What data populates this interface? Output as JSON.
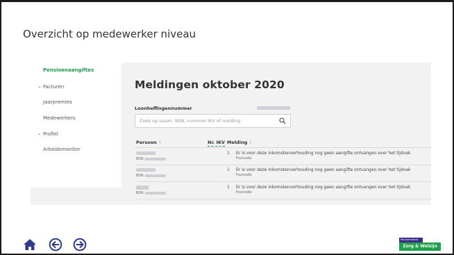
{
  "slide": {
    "title": "Overzicht op medewerker niveau"
  },
  "sidebar": {
    "items": [
      {
        "label": "Pensioenaangiftes",
        "active": true,
        "chevron": false
      },
      {
        "label": "Facturen",
        "active": false,
        "chevron": true
      },
      {
        "label": "Jaarpremies",
        "active": false,
        "chevron": false
      },
      {
        "label": "Medewerkers",
        "active": false,
        "chevron": false
      },
      {
        "label": "Profiel",
        "active": false,
        "chevron": true
      },
      {
        "label": "Arbeidsmonitor",
        "active": false,
        "chevron": false
      }
    ]
  },
  "main": {
    "title": "Meldingen oktober 2020",
    "loonheffing_label": "Loonheffingennummer",
    "search": {
      "placeholder": "Zoek op naam, BSN, nummer IKV of melding",
      "value": ""
    },
    "table": {
      "columns": [
        "Persoon",
        "Nr. IKV",
        "Melding"
      ],
      "rows": [
        {
          "bsn_label": "BSN:",
          "ikv": "1",
          "melding": "Er is voor deze inkomstenverhouding nog geen aangifte ontvangen over het tijdvak",
          "foutcode": "Foutcode:"
        },
        {
          "bsn_label": "BSN:",
          "ikv": "1",
          "melding": "Er is voor deze inkomstenverhouding nog geen aangifte ontvangen over het tijdvak",
          "foutcode": "Foutcode:"
        },
        {
          "bsn_label": "BSN:",
          "ikv": "1",
          "melding": "Er is voor deze inkomstenverhouding nog geen aangifte ontvangen over het tijdvak",
          "foutcode": "Foutcode:"
        }
      ]
    }
  },
  "footer": {
    "icons": [
      "home-icon",
      "back-arrow-icon",
      "forward-arrow-icon"
    ],
    "logo": {
      "top": "Pensioenfonds",
      "main": "Zorg & Welzijn"
    }
  },
  "colors": {
    "accent": "#1f9a4a",
    "nav_icon": "#2c3e8c",
    "logo_purple": "#3a2a8c",
    "logo_green": "#20a04a"
  }
}
